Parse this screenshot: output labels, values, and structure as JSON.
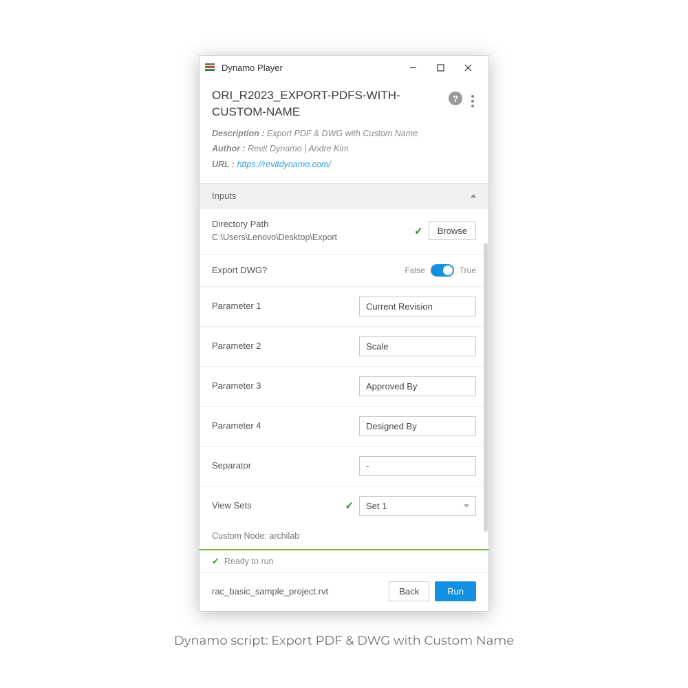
{
  "window": {
    "title": "Dynamo Player"
  },
  "script": {
    "name": "ORI_R2023_EXPORT-PDFS-WITH-CUSTOM-NAME",
    "descLabel": "Description :",
    "desc": "Export PDF & DWG with Custom Name",
    "authorLabel": "Author :",
    "author": "Revit Dynamo | Andre Kim",
    "urlLabel": "URL :",
    "url": "https://revitdynamo.com/"
  },
  "section": {
    "inputs": "Inputs"
  },
  "fields": {
    "dirPath": {
      "label": "Directory Path",
      "value": "C:\\Users\\Lenovo\\Desktop\\Export",
      "browse": "Browse"
    },
    "exportDwg": {
      "label": "Export DWG?",
      "falseTxt": "False",
      "trueTxt": "True",
      "value": true
    },
    "param1": {
      "label": "Parameter 1",
      "value": "Current Revision"
    },
    "param2": {
      "label": "Parameter 2",
      "value": "Scale"
    },
    "param3": {
      "label": "Parameter 3",
      "value": "Approved By"
    },
    "param4": {
      "label": "Parameter 4",
      "value": "Designed By"
    },
    "separator": {
      "label": "Separator",
      "value": "-"
    },
    "viewSets": {
      "label": "View Sets",
      "value": "Set 1"
    },
    "customNode": "Custom Node: archilab"
  },
  "status": {
    "text": "Ready to run"
  },
  "footer": {
    "file": "rac_basic_sample_project.rvt",
    "back": "Back",
    "run": "Run"
  },
  "caption": "Dynamo script: Export PDF & DWG with Custom Name"
}
